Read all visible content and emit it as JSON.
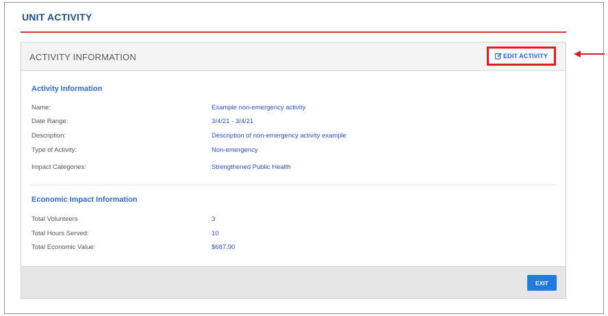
{
  "page": {
    "title": "UNIT ACTIVITY"
  },
  "panel": {
    "title": "ACTIVITY INFORMATION",
    "edit_label": "EDIT ACTIVITY"
  },
  "activity": {
    "heading": "Activity Information",
    "rows": [
      {
        "label": "Name:",
        "value": "Example non-emergency activity"
      },
      {
        "label": "Date Range:",
        "value": "3/4/21 - 3/4/21"
      },
      {
        "label": "Description:",
        "value": "Description of non-emergency activity example"
      },
      {
        "label": "Type of Activity:",
        "value": "Non-emergency"
      },
      {
        "label": "Impact Categories:",
        "value": "Strengthened Public Health"
      }
    ]
  },
  "economic": {
    "heading": "Economic Impact Information",
    "rows": [
      {
        "label": "Total Volunteers",
        "value": "3"
      },
      {
        "label": "Total Hours Served:",
        "value": "10"
      },
      {
        "label": "Total Economic Value:",
        "value": "$687.90"
      }
    ]
  },
  "footer": {
    "exit_label": "EXIT"
  },
  "colors": {
    "accent": "#2f6bd1",
    "rule": "#d9322b",
    "highlight": "#e01b1b",
    "button": "#1f7be0"
  },
  "icons": {
    "edit": "edit-icon",
    "arrow": "left-arrow-annotation"
  }
}
